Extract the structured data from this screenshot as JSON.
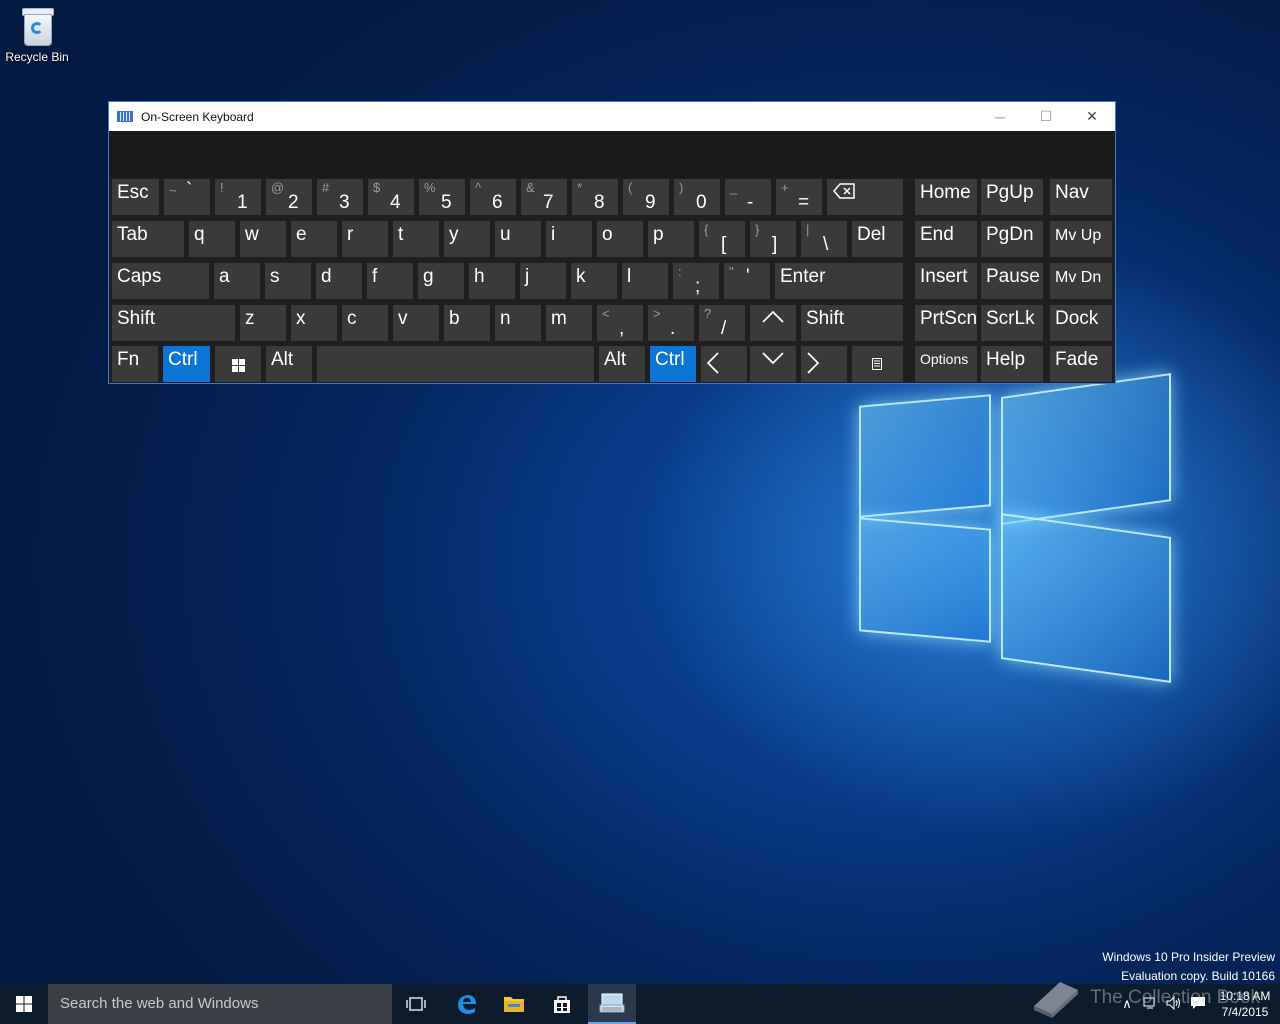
{
  "desktop": {
    "recycle_bin": "Recycle Bin"
  },
  "window": {
    "title": "On-Screen Keyboard",
    "minimize": "─",
    "maximize": "☐",
    "close": "✕"
  },
  "keys": {
    "esc": "Esc",
    "tilde_s": "~",
    "tilde_m": "`",
    "n1_s": "!",
    "n1_m": "1",
    "n2_s": "@",
    "n2_m": "2",
    "n3_s": "#",
    "n3_m": "3",
    "n4_s": "$",
    "n4_m": "4",
    "n5_s": "%",
    "n5_m": "5",
    "n6_s": "^",
    "n6_m": "6",
    "n7_s": "&",
    "n7_m": "7",
    "n8_s": "*",
    "n8_m": "8",
    "n9_s": "(",
    "n9_m": "9",
    "n0_s": ")",
    "n0_m": "0",
    "minus_s": "_",
    "minus_m": "-",
    "eq_s": "+",
    "eq_m": "=",
    "home": "Home",
    "pgup": "PgUp",
    "nav": "Nav",
    "tab": "Tab",
    "q": "q",
    "w": "w",
    "e": "e",
    "r": "r",
    "t": "t",
    "y": "y",
    "u": "u",
    "i": "i",
    "o": "o",
    "p": "p",
    "lbr_s": "{",
    "lbr_m": "[",
    "rbr_s": "}",
    "rbr_m": "]",
    "bs_s": "|",
    "bs_m": "\\",
    "del": "Del",
    "end": "End",
    "pgdn": "PgDn",
    "mvup": "Mv Up",
    "caps": "Caps",
    "a": "a",
    "s": "s",
    "d": "d",
    "f": "f",
    "g": "g",
    "h": "h",
    "j": "j",
    "k": "k",
    "l": "l",
    "semi_s": ":",
    "semi_m": ";",
    "quote_s": "\"",
    "quote_m": "'",
    "enter": "Enter",
    "insert": "Insert",
    "pause": "Pause",
    "mvdn": "Mv Dn",
    "shift": "Shift",
    "z": "z",
    "x": "x",
    "c": "c",
    "v": "v",
    "b": "b",
    "n": "n",
    "m": "m",
    "comma_s": "<",
    "comma_m": ",",
    "period_s": ">",
    "period_m": ".",
    "slash_s": "?",
    "slash_m": "/",
    "rshift": "Shift",
    "prtscn": "PrtScn",
    "scrlk": "ScrLk",
    "dock": "Dock",
    "fn": "Fn",
    "ctrl": "Ctrl",
    "alt": "Alt",
    "ralt": "Alt",
    "rctrl": "Ctrl",
    "options": "Options",
    "help": "Help",
    "fade": "Fade"
  },
  "taskbar": {
    "search_placeholder": "Search the web and Windows",
    "time": "10:18 AM",
    "date": "7/4/2015"
  },
  "watermark": {
    "line1": "Windows 10 Pro Insider Preview",
    "line2": "Evaluation copy. Build 10166"
  },
  "brand": "The Collection Book",
  "colors": {
    "accent": "#0b76d6",
    "key": "#3a3a3a",
    "osk_bg": "#1f1f1f",
    "taskbar": "#0c1c2d"
  }
}
